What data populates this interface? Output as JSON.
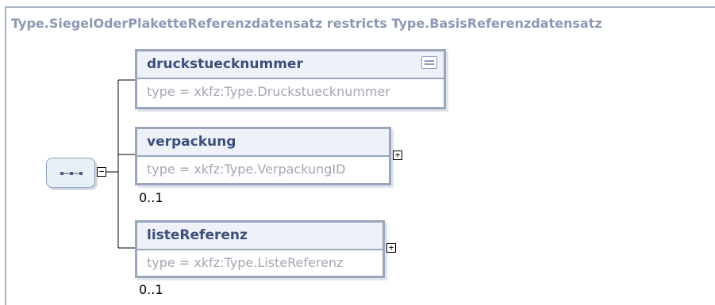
{
  "diagram": {
    "title": "Type.SiegelOderPlaketteReferenzdatensatz restricts Type.BasisReferenzdatensatz",
    "sequence": {
      "toggle": "−"
    },
    "elements": [
      {
        "name": "druckstuecknummer",
        "type": "type = xkfz:Type.Druckstuecknummer",
        "cardinality": "",
        "has_doc_icon": true,
        "expandable": false
      },
      {
        "name": "verpackung",
        "type": "type = xkfz:Type.VerpackungID",
        "cardinality": "0..1",
        "has_doc_icon": false,
        "expandable": true,
        "toggle": "+"
      },
      {
        "name": "listeReferenz",
        "type": "type = xkfz:Type.ListeReferenz",
        "cardinality": "0..1",
        "has_doc_icon": false,
        "expandable": true,
        "toggle": "+"
      }
    ]
  }
}
